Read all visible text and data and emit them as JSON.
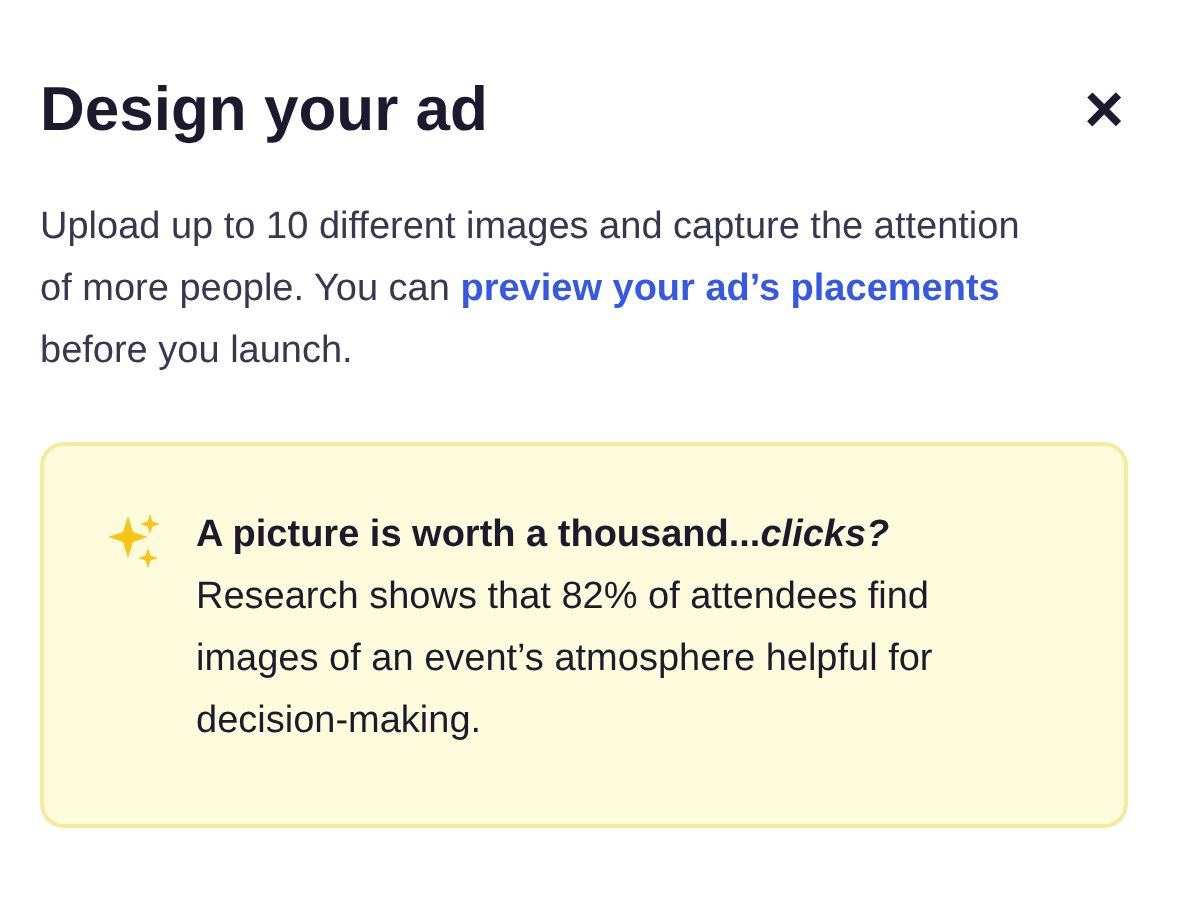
{
  "dialog": {
    "title": "Design your ad",
    "close": "×"
  },
  "intro": {
    "text_before": "Upload up to 10 different images and capture the attention of more people. You can ",
    "link": "preview your ad’s placements",
    "text_after": " before you launch."
  },
  "tip": {
    "heading": "A picture is worth a thousand...*clicks?*",
    "body": "Research shows that 82% of attendees find images of an event’s atmosphere helpful for decision-making."
  }
}
